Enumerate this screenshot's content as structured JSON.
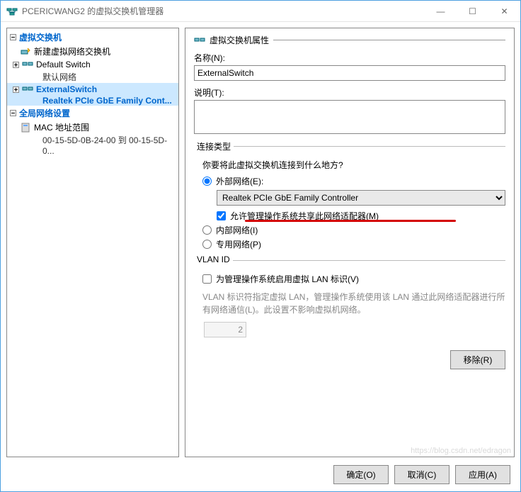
{
  "window": {
    "title": "PCERICWANG2 的虚拟交换机管理器",
    "min": "—",
    "max": "☐",
    "close": "✕"
  },
  "tree": {
    "header1": "虚拟交换机",
    "newSwitch": "新建虚拟网络交换机",
    "defaultSwitch": "Default Switch",
    "defaultSwitchSub": "默认网络",
    "externalSwitch": "ExternalSwitch",
    "externalSwitchSub": "Realtek PCIe GbE Family Cont...",
    "header2": "全局网络设置",
    "mac": "MAC 地址范围",
    "macSub": "00-15-5D-0B-24-00 到 00-15-5D-0..."
  },
  "props": {
    "sectionTitle": "虚拟交换机属性",
    "nameLabel": "名称(N):",
    "nameValue": "ExternalSwitch",
    "descLabel": "说明(T):",
    "descValue": ""
  },
  "connection": {
    "legend": "连接类型",
    "question": "你要将此虚拟交换机连接到什么地方?",
    "external": "外部网络(E):",
    "adapter": "Realtek PCIe GbE Family Controller",
    "shareMgmt": "允许管理操作系统共享此网络适配器(M)",
    "internal": "内部网络(I)",
    "private": "专用网络(P)"
  },
  "vlan": {
    "legend": "VLAN ID",
    "enable": "为管理操作系统启用虚拟 LAN 标识(V)",
    "desc": "VLAN 标识符指定虚拟 LAN，管理操作系统使用该 LAN 通过此网络适配器进行所有网络通信(L)。此设置不影响虚拟机网络。",
    "value": "2"
  },
  "buttons": {
    "remove": "移除(R)",
    "ok": "确定(O)",
    "cancel": "取消(C)",
    "apply": "应用(A)"
  },
  "watermark": "https://blog.csdn.net/edragon"
}
